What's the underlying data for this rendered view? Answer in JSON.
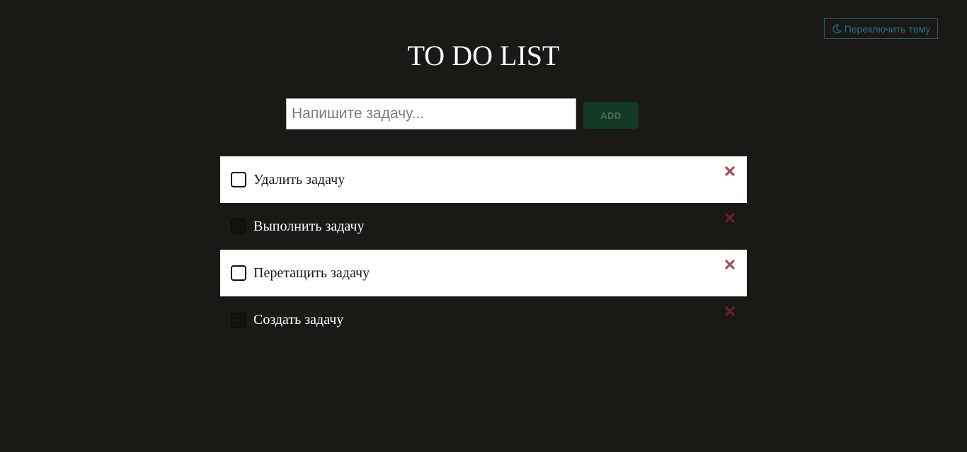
{
  "header": {
    "theme_toggle_label": "Переключить тему",
    "theme_toggle_icon": "moon-icon",
    "title": "TO DO LIST"
  },
  "form": {
    "input_placeholder": "Напишите задачу...",
    "input_value": "",
    "add_label": "ADD"
  },
  "tasks": [
    {
      "text": "Удалить задачу",
      "checked": false,
      "style": "light"
    },
    {
      "text": "Выполнить задачу",
      "checked": false,
      "style": "dark"
    },
    {
      "text": "Перетащить задачу",
      "checked": false,
      "style": "light"
    },
    {
      "text": "Создать задачу",
      "checked": false,
      "style": "dark"
    }
  ],
  "colors": {
    "background": "#1b1915",
    "accent_blue": "#2b6e88",
    "add_button_bg": "#123a22",
    "delete_light": "#a44e57",
    "delete_dark": "#6b2126"
  }
}
